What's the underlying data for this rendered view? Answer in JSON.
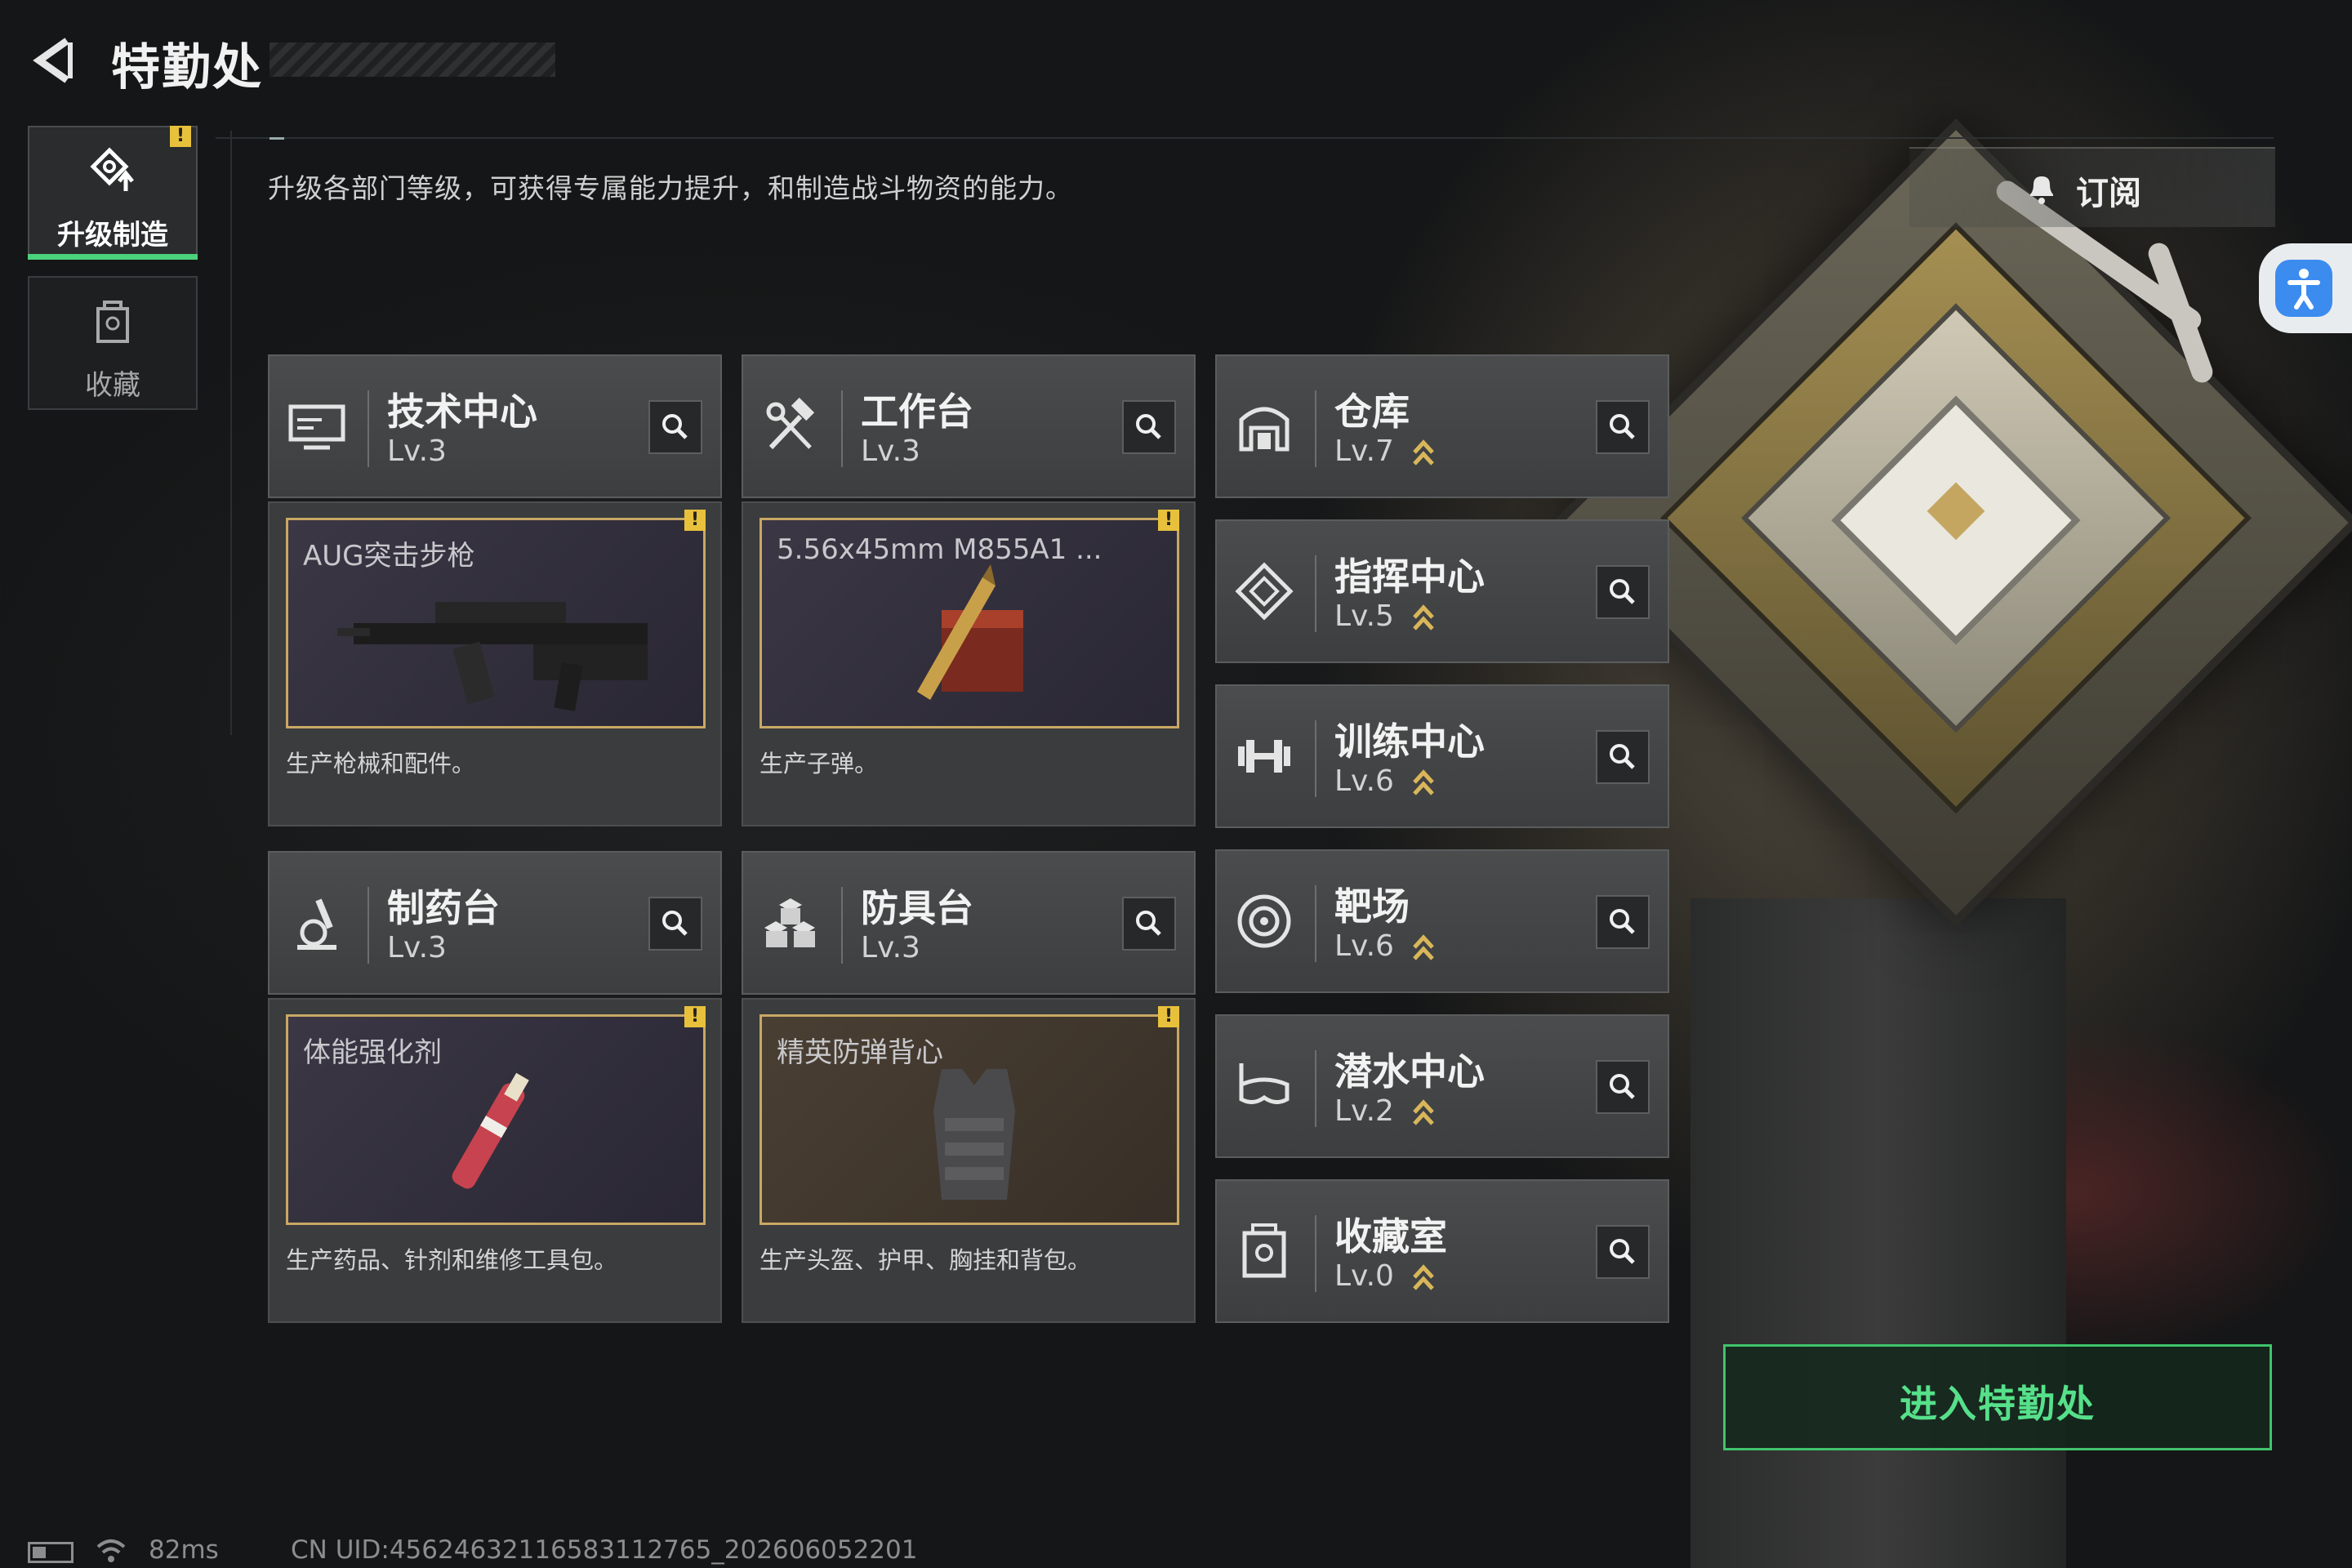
{
  "header": {
    "title": "特勤处"
  },
  "subtitle": "升级各部门等级，可获得专属能力提升，和制造战斗物资的能力。",
  "sidebar": {
    "tabs": [
      {
        "label": "升级制造",
        "icon": "upgrade-icon",
        "active": true,
        "warning": true
      },
      {
        "label": "收藏",
        "icon": "collection-icon",
        "active": false,
        "warning": false
      }
    ]
  },
  "subscribe": {
    "label": "订阅",
    "icon": "bell-icon"
  },
  "departments_main": [
    {
      "name": "技术中心",
      "level": "Lv.3",
      "icon": "monitor-icon",
      "item": "AUG突击步枪",
      "desc": "生产枪械和配件。",
      "warning": true
    },
    {
      "name": "工作台",
      "level": "Lv.3",
      "icon": "hammer-wrench-icon",
      "item": "5.56x45mm M855A1 ...",
      "desc": "生产子弹。",
      "warning": true
    },
    {
      "name": "制药台",
      "level": "Lv.3",
      "icon": "microscope-icon",
      "item": "体能强化剂",
      "desc": "生产药品、针剂和维修工具包。",
      "warning": true
    },
    {
      "name": "防具台",
      "level": "Lv.3",
      "icon": "armor-blocks-icon",
      "item": "精英防弹背心",
      "desc": "生产头盔、护甲、胸挂和背包。",
      "warning": true
    }
  ],
  "departments_side": [
    {
      "name": "仓库",
      "level": "Lv.7",
      "icon": "warehouse-icon",
      "upgradable": true
    },
    {
      "name": "指挥中心",
      "level": "Lv.5",
      "icon": "command-diamond-icon",
      "upgradable": true
    },
    {
      "name": "训练中心",
      "level": "Lv.6",
      "icon": "dumbbell-icon",
      "upgradable": true
    },
    {
      "name": "靶场",
      "level": "Lv.6",
      "icon": "target-icon",
      "upgradable": true
    },
    {
      "name": "潜水中心",
      "level": "Lv.2",
      "icon": "diving-mask-icon",
      "upgradable": true
    },
    {
      "name": "收藏室",
      "level": "Lv.0",
      "icon": "collection-room-icon",
      "upgradable": true
    }
  ],
  "enter_button": {
    "label": "进入特勤处"
  },
  "statusbar": {
    "ping": "82ms",
    "uid": "CN UID:4562463211658311276​5_202606052201"
  },
  "colors": {
    "accent_green": "#3fc46c",
    "warning_yellow": "#e8c13c",
    "frame_gold": "#c9a864",
    "upgrade_arrow": "#d9b65a"
  }
}
